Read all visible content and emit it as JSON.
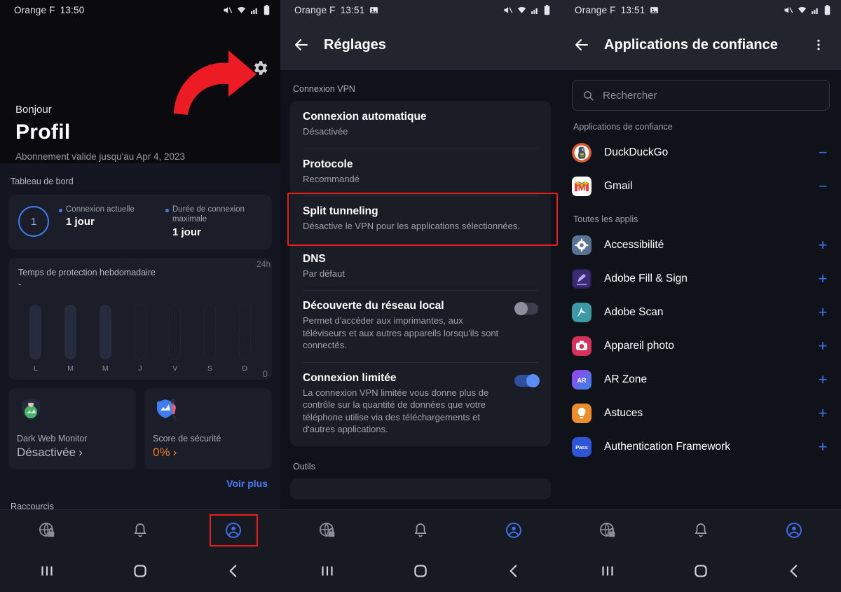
{
  "panels": {
    "profile": {
      "status": {
        "carrier": "Orange F",
        "time": "13:50"
      },
      "greeting": "Bonjour",
      "title": "Profil",
      "subtitle": "Abonnement valide jusqu'au Apr 4, 2023",
      "dashboard_label": "Tableau de bord",
      "connection": {
        "count": "1",
        "current_label": "Connexion actuelle",
        "current_value": "1 jour",
        "max_label": "Durée de connexion maximale",
        "max_value": "1 jour"
      },
      "chart_card": {
        "title": "Temps de protection hebdomadaire",
        "value": "-"
      },
      "tiles": [
        {
          "name": "Dark Web Monitor",
          "value": "Désactivée",
          "chevron": "›",
          "accent": "#b7b9c4"
        },
        {
          "name": "Score de sécurité",
          "value": "0%",
          "chevron": "›",
          "accent": "#e98228"
        }
      ],
      "see_more": "Voir plus",
      "shortcuts_label": "Raccourcis",
      "bottom_nav": [
        {
          "icon": "globe-lock-icon",
          "active": false
        },
        {
          "icon": "bell-icon",
          "active": false
        },
        {
          "icon": "account-circle-icon",
          "active": true
        }
      ],
      "sys_nav": [
        {
          "icon": "recents-icon",
          "glyph": "|||"
        },
        {
          "icon": "home-icon",
          "glyph": "▢"
        },
        {
          "icon": "back-icon",
          "glyph": "‹"
        }
      ]
    },
    "settings": {
      "status": {
        "carrier": "Orange F",
        "time": "13:51"
      },
      "header_title": "Réglages",
      "group_label": "Connexion VPN",
      "rows": [
        {
          "title": "Connexion automatique",
          "sub": "Désactivée",
          "toggle": null
        },
        {
          "title": "Protocole",
          "sub": "Recommandé",
          "toggle": null
        },
        {
          "title": "Split tunneling",
          "sub": "Désactive le VPN pour les applications sélectionnées.",
          "toggle": null,
          "highlighted": true
        },
        {
          "title": "DNS",
          "sub": "Par défaut",
          "toggle": null
        },
        {
          "title": "Découverte du réseau local",
          "sub": "Permet d'accéder aux imprimantes, aux téléviseurs et aux autres appareils lorsqu'ils sont connectés.",
          "toggle": "off"
        },
        {
          "title": "Connexion limitée",
          "sub": "La connexion VPN limitée vous donne plus de contrôle sur la quantité de données que votre téléphone utilise via des téléchargements et d'autres applications.",
          "toggle": "on"
        }
      ],
      "group_label_2": "Outils"
    },
    "trusted_apps": {
      "status": {
        "carrier": "Orange F",
        "time": "13:51"
      },
      "header_title": "Applications de confiance",
      "search_placeholder": "Rechercher",
      "trusted_label": "Applications de confiance",
      "all_label": "Toutes les applis",
      "trusted": [
        {
          "name": "DuckDuckGo",
          "action": "−",
          "icon": "duckduckgo-icon"
        },
        {
          "name": "Gmail",
          "action": "−",
          "icon": "gmail-icon"
        }
      ],
      "all_apps": [
        {
          "name": "Accessibilité",
          "action": "+",
          "icon": "accessibility-icon"
        },
        {
          "name": "Adobe Fill & Sign",
          "action": "+",
          "icon": "adobe-fill-sign-icon"
        },
        {
          "name": "Adobe Scan",
          "action": "+",
          "icon": "adobe-scan-icon"
        },
        {
          "name": "Appareil photo",
          "action": "+",
          "icon": "camera-icon"
        },
        {
          "name": "AR Zone",
          "action": "+",
          "icon": "ar-zone-icon"
        },
        {
          "name": "Astuces",
          "action": "+",
          "icon": "tips-icon"
        },
        {
          "name": "Authentication Framework",
          "action": "+",
          "icon": "authentication-framework-icon"
        }
      ]
    }
  },
  "chart_data": {
    "type": "bar",
    "title": "Temps de protection hebdomadaire",
    "categories": [
      "L",
      "M",
      "M",
      "J",
      "V",
      "S",
      "D"
    ],
    "values": [
      0,
      0,
      0,
      null,
      null,
      null,
      null
    ],
    "bar_states": [
      "filled",
      "filled",
      "filled",
      "empty",
      "empty",
      "empty",
      "empty"
    ],
    "ylabel": "",
    "ytick_top": "24h",
    "ytick_bottom": "0",
    "ylim": [
      0,
      24
    ],
    "grid": false,
    "legend": false
  },
  "colors": {
    "accent_blue": "#3d6ef0",
    "highlight_red": "#ee1c1c",
    "orange": "#e98228",
    "panel_bg": "#101219",
    "card_bg": "#1a1c26",
    "header_bg": "#22242e"
  }
}
